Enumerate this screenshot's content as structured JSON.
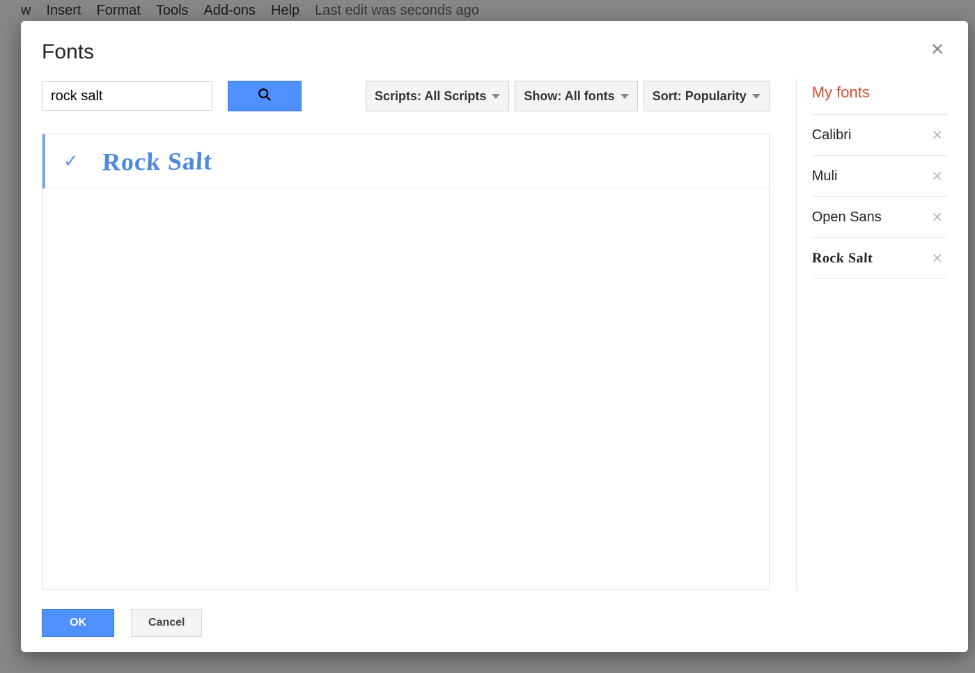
{
  "bg_menu": {
    "items": [
      "w",
      "Insert",
      "Format",
      "Tools",
      "Add-ons",
      "Help"
    ],
    "status": "Last edit was seconds ago"
  },
  "dialog": {
    "title": "Fonts",
    "search_value": "rock salt",
    "filters": {
      "scripts_label": "Scripts: All Scripts",
      "show_label": "Show: All fonts",
      "sort_label": "Sort: Popularity"
    },
    "results": [
      {
        "name": "Rock Salt",
        "checked": true
      }
    ],
    "my_fonts_title": "My fonts",
    "my_fonts": [
      {
        "name": "Calibri",
        "style": "plain"
      },
      {
        "name": "Muli",
        "style": "plain"
      },
      {
        "name": "Open Sans",
        "style": "plain"
      },
      {
        "name": "Rock Salt",
        "style": "rocksalt"
      }
    ],
    "ok_label": "OK",
    "cancel_label": "Cancel"
  }
}
